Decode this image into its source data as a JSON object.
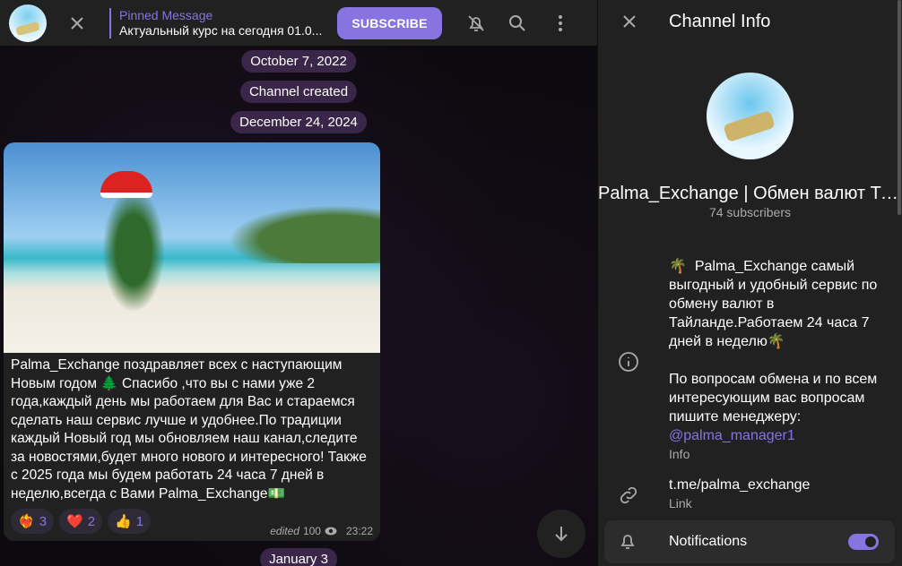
{
  "header": {
    "pinned_title": "Pinned Message",
    "pinned_text": "Актуальный курс на сегодня 01.0...",
    "subscribe": "SUBSCRIBE"
  },
  "chat": {
    "dates": [
      "October 7, 2022",
      "Channel created",
      "December 24, 2024",
      "January 3"
    ],
    "message": {
      "text": "Palma_Exchange поздравляет всех с наступающим Новым годом 🌲 Спасибо ,что вы с нами уже 2 года,каждый день мы работаем для Вас и стараемся сделать наш сервис лучше и удобнее.По традиции каждый Новый год мы обновляем наш канал,следите за новостями,будет много нового и интересного! Также с 2025 года мы будем работать 24 часа 7 дней в неделю,всегда с Вами Palma_Exchange💵",
      "reactions": [
        {
          "emoji": "❤️‍🔥",
          "count": "3"
        },
        {
          "emoji": "❤️",
          "count": "2"
        },
        {
          "emoji": "👍",
          "count": "1"
        }
      ],
      "edited": "edited",
      "views": "100",
      "time": "23:22"
    }
  },
  "panel": {
    "title": "Channel Info",
    "name": "Palma_Exchange | Обмен валют Таиланд",
    "subscribers": "74 subscribers",
    "info_text": "🌴  Palma_Exchange самый выгодный и удобный сервис по обмену валют в Тайланде.Работаем 24 часа 7 дней в неделю🌴\n\nПо вопросам обмена и по всем интересующим вас вопросам пишите менеджеру:",
    "info_link": "@palma_manager1",
    "info_label": "Info",
    "link": "t.me/palma_exchange",
    "link_label": "Link",
    "notifications": "Notifications",
    "notifications_on": true
  },
  "colors": {
    "accent": "#8774e1",
    "panel": "#212121"
  }
}
